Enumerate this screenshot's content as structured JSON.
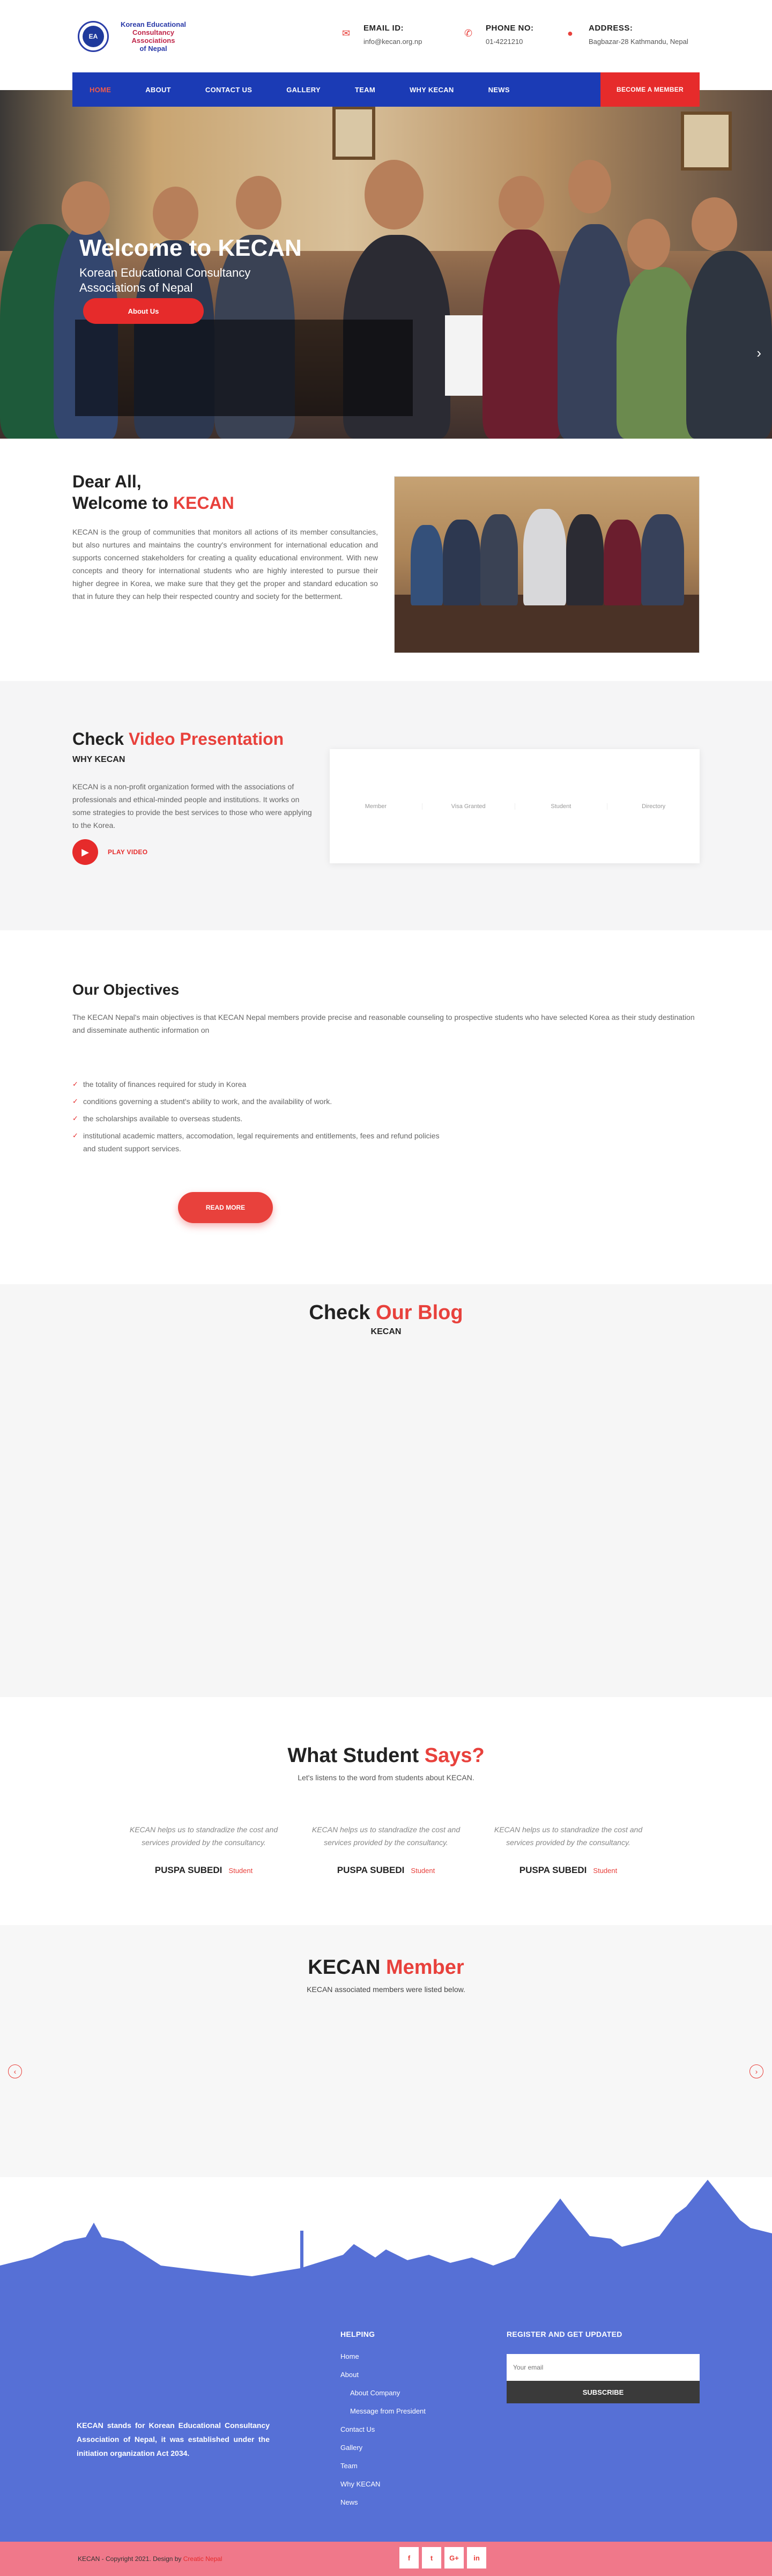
{
  "header": {
    "logo_initials": "EA",
    "logo_line1": "Korean Educational",
    "logo_line2": "Consultancy Associations",
    "logo_line3": "of Nepal",
    "email_label": "EMAIL ID:",
    "email_value": "info@kecan.org.np",
    "phone_label": "PHONE NO:",
    "phone_value": "01-4221210",
    "address_label": "ADDRESS:",
    "address_value": "Bagbazar-28 Kathmandu, Nepal"
  },
  "nav": {
    "items": [
      "HOME",
      "ABOUT",
      "CONTACT US",
      "GALLERY",
      "TEAM",
      "WHY KECAN",
      "NEWS"
    ],
    "cta": "BECOME A MEMBER"
  },
  "hero": {
    "title": "Welcome to KECAN",
    "subtitle": "Korean Educational Consultancy Associations of Nepal",
    "button": "About Us"
  },
  "dear": {
    "line1": "Dear All,",
    "line2a": "Welcome to ",
    "line2b": "KECAN",
    "body": "KECAN is the group of communities that monitors all actions of its member consultancies, but also nurtures and maintains the country's environment for international education and supports concerned stakeholders for creating a quality educational environment. With new concepts and theory for international students who are highly interested to pursue their higher degree in Korea, we make sure that they get the proper and standard education so that in future they can help their respected country and society for the betterment."
  },
  "video": {
    "title_a": "Check ",
    "title_b": "Video Presentation",
    "subtitle": "WHY KECAN",
    "body": "KECAN is a non-profit organization formed with the associations of professionals and ethical-minded people and institutions. It works on some strategies to provide the best services to those who were applying to the Korea.",
    "play_label": "PLAY VIDEO",
    "stats": [
      "Member",
      "Visa Granted",
      "Student",
      "Directory"
    ]
  },
  "objectives": {
    "title": "Our Objectives",
    "intro": "The KECAN Nepal's main objectives is that KECAN Nepal members provide precise and reasonable counseling to prospective students who have selected Korea as their study destination and disseminate authentic information on",
    "items": [
      "the totality of finances required for study in Korea",
      "conditions governing a student's ability to work, and the availability of work.",
      "the scholarships available to overseas students.",
      "institutional academic matters, accomodation, legal requirements and entitlements, fees and refund policies and student support services."
    ],
    "button": "READ MORE"
  },
  "blog": {
    "title_a": "Check ",
    "title_b": "Our Blog",
    "subtitle": "KECAN"
  },
  "testimonials": {
    "title_a": "What Student ",
    "title_b": "Says?",
    "subtitle": "Let's listens to the word from students about KECAN.",
    "cards": [
      {
        "quote": "KECAN helps us to standradize the cost and services provided by the consultancy.",
        "name": "PUSPA SUBEDI",
        "role": "Student"
      },
      {
        "quote": "KECAN helps us to standradize the cost and services provided by the consultancy.",
        "name": "PUSPA SUBEDI",
        "role": "Student"
      },
      {
        "quote": "KECAN helps us to standradize the cost and services provided by the consultancy.",
        "name": "PUSPA SUBEDI",
        "role": "Student"
      }
    ]
  },
  "members": {
    "title_a": "KECAN ",
    "title_b": "Member",
    "subtitle": "KECAN associated members were listed below."
  },
  "footer": {
    "about": "KECAN stands for Korean Educational Consultancy Association of Nepal, it was established under the initiation organization Act 2034.",
    "helping_title": "HELPING",
    "links": [
      "Home",
      "About",
      "About Company",
      "Message from President",
      "Contact Us",
      "Gallery",
      "Team",
      "Why KECAN",
      "News"
    ],
    "register_title": "REGISTER AND GET UPDATED",
    "email_placeholder": "Your email",
    "subscribe": "SUBSCRIBE",
    "copyright": "KECAN - Copyright 2021. Design by ",
    "designer": "Creatic Nepal",
    "social": [
      "f",
      "t",
      "G+",
      "in"
    ]
  },
  "colors": {
    "nav": "#1b3bb5",
    "accent": "#e8413c",
    "footer": "#5670d6",
    "bottom": "#f0788a"
  }
}
